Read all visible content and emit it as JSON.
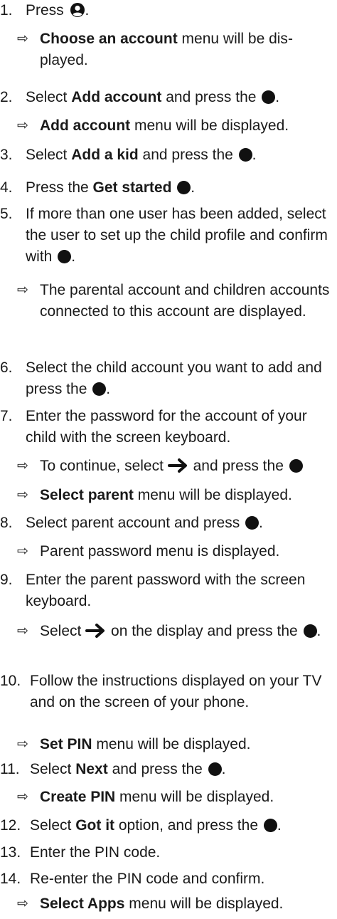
{
  "items": [
    {
      "kind": "step",
      "num": "1.",
      "parts": [
        {
          "t": "Press "
        },
        {
          "icon": "profile-icon"
        },
        {
          "t": "."
        }
      ]
    },
    {
      "kind": "result",
      "parts": [
        {
          "b": "Choose an account"
        },
        {
          "t": " menu will be dis­played."
        }
      ]
    },
    {
      "kind": "step",
      "num": "2.",
      "parts": [
        {
          "t": "Select "
        },
        {
          "b": "Add account"
        },
        {
          "t": " and press the "
        },
        {
          "icon": "ok-button-icon"
        },
        {
          "t": "."
        }
      ]
    },
    {
      "kind": "result",
      "parts": [
        {
          "b": "Add account"
        },
        {
          "t": " menu will be displayed."
        }
      ]
    },
    {
      "kind": "step",
      "num": "3.",
      "parts": [
        {
          "t": "Select "
        },
        {
          "b": "Add a kid"
        },
        {
          "t": " and press the "
        },
        {
          "icon": "ok-button-icon"
        },
        {
          "t": "."
        }
      ]
    },
    {
      "kind": "step",
      "num": "4.",
      "parts": [
        {
          "t": "Press the "
        },
        {
          "b": "Get started"
        },
        {
          "t": " "
        },
        {
          "icon": "ok-button-icon"
        },
        {
          "t": "."
        }
      ]
    },
    {
      "kind": "step",
      "num": "5.",
      "parts": [
        {
          "t": "If more than one user has been added, select the user to set up the child profile and confirm with "
        },
        {
          "icon": "ok-button-icon"
        },
        {
          "t": "."
        }
      ]
    },
    {
      "kind": "result",
      "parts": [
        {
          "t": "The parental account and children ac­counts connected to this account are displayed."
        }
      ]
    },
    {
      "kind": "step",
      "num": "6.",
      "parts": [
        {
          "t": "Select the child account you want to add and press the "
        },
        {
          "icon": "ok-button-icon"
        },
        {
          "t": "."
        }
      ]
    },
    {
      "kind": "step",
      "num": "7.",
      "parts": [
        {
          "t": "Enter the password for the account of your child with the screen keyboard."
        }
      ]
    },
    {
      "kind": "result",
      "parts": [
        {
          "t": "To continue, select "
        },
        {
          "icon": "right-arrow-icon"
        },
        {
          "t": " and press the "
        },
        {
          "icon": "ok-button-icon"
        }
      ]
    },
    {
      "kind": "result",
      "parts": [
        {
          "b": "Select parent"
        },
        {
          "t": " menu will be displayed."
        }
      ]
    },
    {
      "kind": "step",
      "num": "8.",
      "parts": [
        {
          "t": "Select parent account and press "
        },
        {
          "icon": "ok-button-icon"
        },
        {
          "t": "."
        }
      ]
    },
    {
      "kind": "result",
      "parts": [
        {
          "t": "Parent password menu is displayed."
        }
      ]
    },
    {
      "kind": "step",
      "num": "9.",
      "parts": [
        {
          "t": "Enter the parent password with the screen keyboard."
        }
      ]
    },
    {
      "kind": "result",
      "parts": [
        {
          "t": "Select "
        },
        {
          "icon": "right-arrow-icon"
        },
        {
          "t": " on the display and press the "
        },
        {
          "icon": "ok-button-icon"
        },
        {
          "t": "."
        }
      ]
    },
    {
      "kind": "step",
      "num": "10.",
      "parts": [
        {
          "t": "Follow the instructions displayed on your TV and on the screen of your phone."
        }
      ]
    },
    {
      "kind": "result",
      "parts": [
        {
          "b": "Set PIN"
        },
        {
          "t": " menu will be displayed."
        }
      ]
    },
    {
      "kind": "step",
      "num": "11.",
      "parts": [
        {
          "t": "Select "
        },
        {
          "b": "Next"
        },
        {
          "t": " and press the "
        },
        {
          "icon": "ok-button-icon"
        },
        {
          "t": "."
        }
      ]
    },
    {
      "kind": "result",
      "parts": [
        {
          "b": "Create PIN"
        },
        {
          "t": " menu will be displayed."
        }
      ]
    },
    {
      "kind": "step",
      "num": "12.",
      "parts": [
        {
          "t": "Select "
        },
        {
          "b": "Got it"
        },
        {
          "t": " option, and press the "
        },
        {
          "icon": "ok-button-icon"
        },
        {
          "t": "."
        }
      ]
    },
    {
      "kind": "step",
      "num": "13.",
      "parts": [
        {
          "t": "Enter the PIN code."
        }
      ]
    },
    {
      "kind": "step",
      "num": "14.",
      "parts": [
        {
          "t": "Re-enter the PIN code and confirm."
        }
      ]
    },
    {
      "kind": "result",
      "parts": [
        {
          "b": "Select Apps"
        },
        {
          "t": " menu will be displayed."
        }
      ]
    }
  ],
  "result_arrow": "⇨"
}
